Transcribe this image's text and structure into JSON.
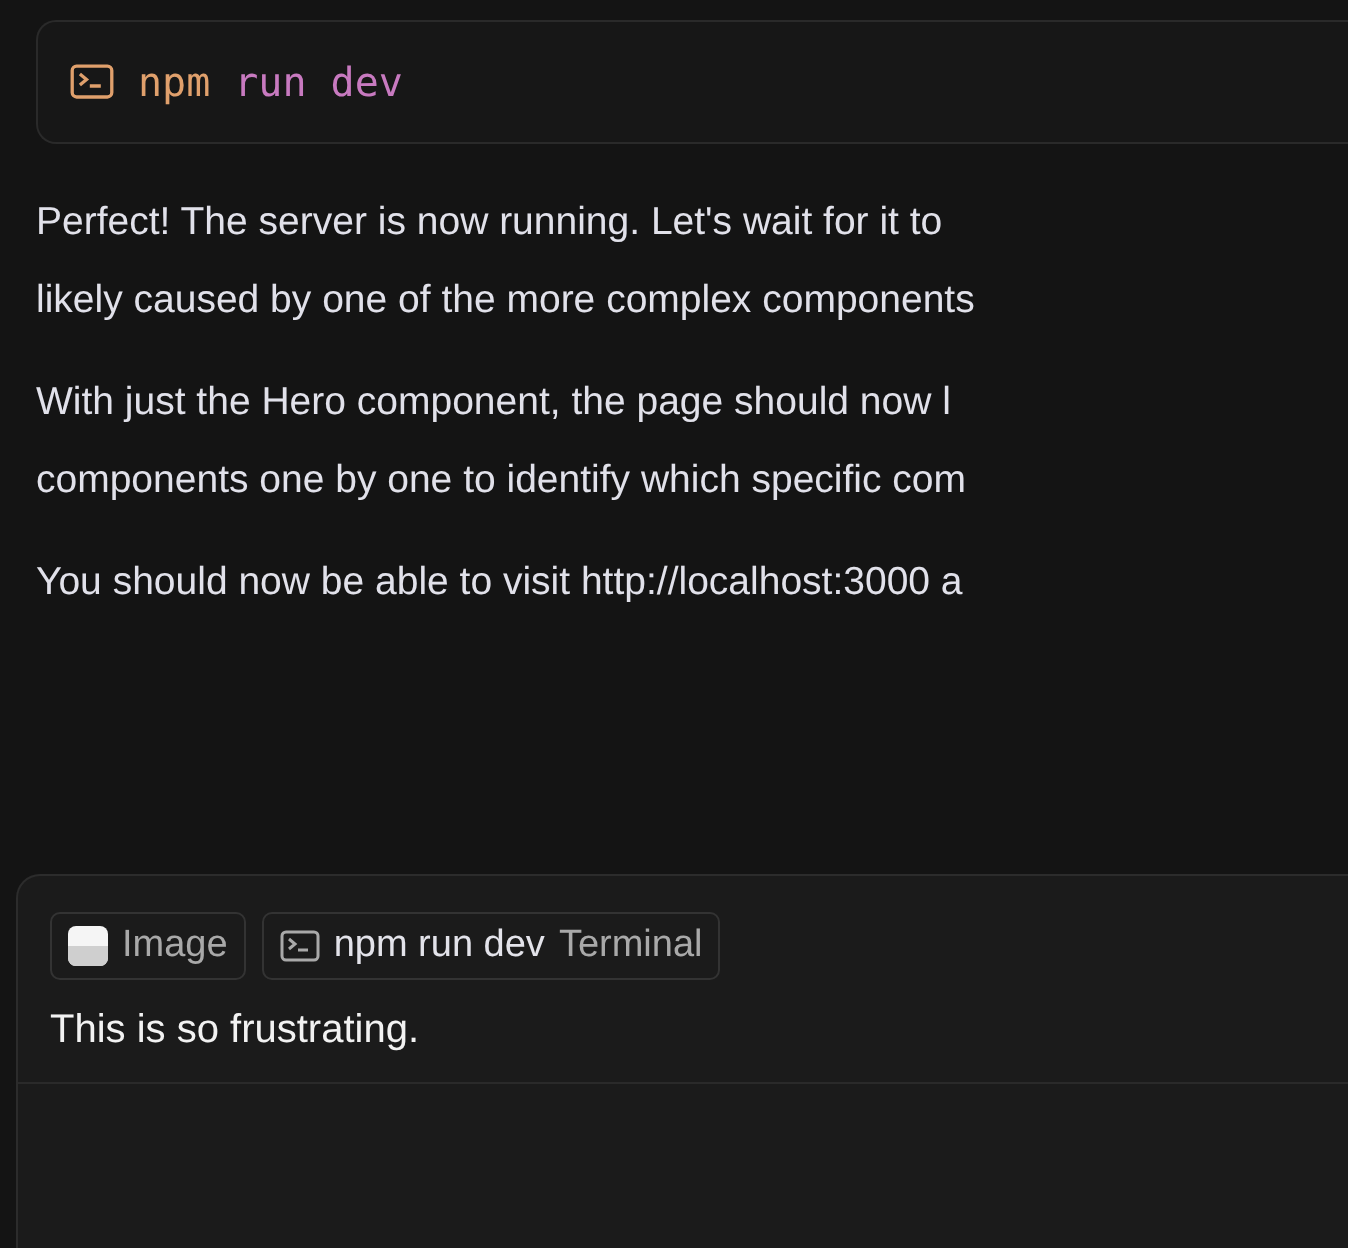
{
  "command": {
    "program": "npm",
    "args": "run dev"
  },
  "paragraphs": [
    [
      "Perfect! The server is now running. Let's wait for it to",
      "likely caused by one of the more complex components"
    ],
    [
      "With just the Hero component, the page should now l",
      "components one by one to identify which specific com"
    ],
    [
      "You should now be able to visit http://localhost:3000 a"
    ]
  ],
  "composer": {
    "attachments": [
      {
        "kind": "image",
        "label": "Image"
      },
      {
        "kind": "terminal",
        "label": "npm run dev",
        "sublabel": "Terminal"
      }
    ],
    "message": "This is so frustrating."
  }
}
